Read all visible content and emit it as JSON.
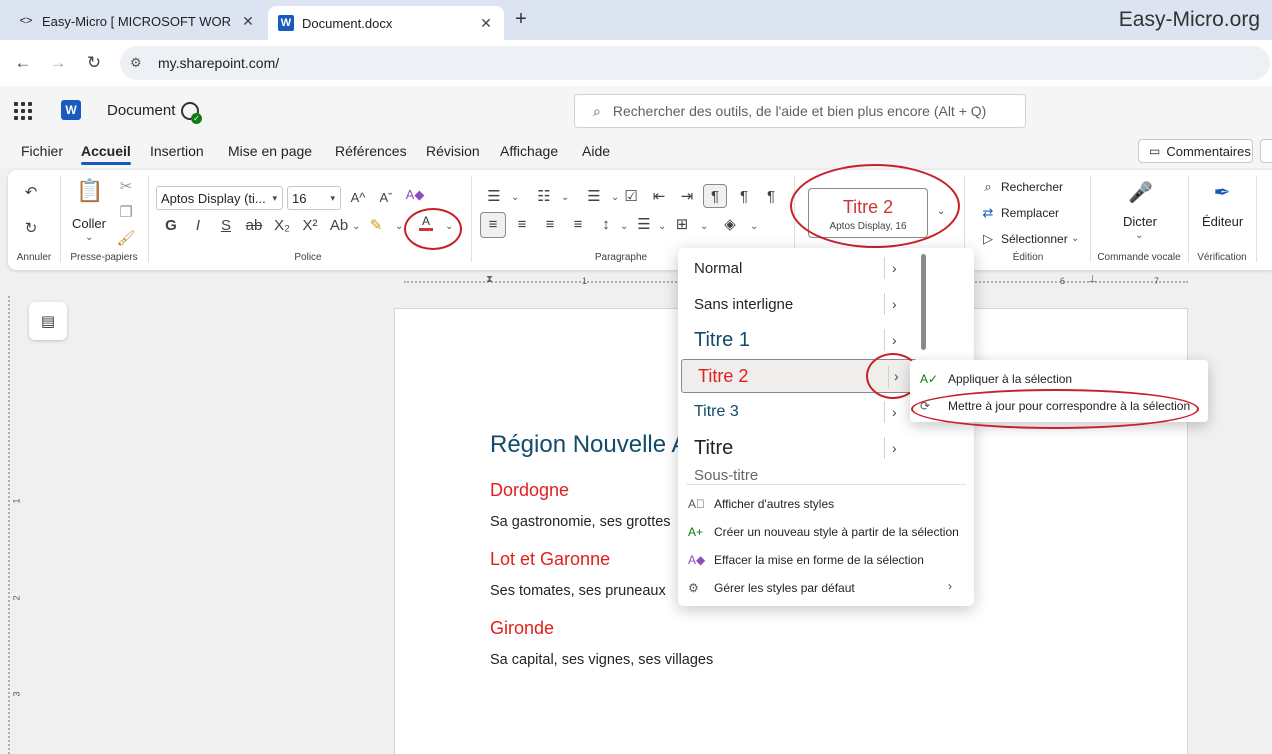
{
  "browser": {
    "tabs": [
      {
        "title": "Easy-Micro [ MICROSOFT WOR",
        "icon": "code-icon"
      },
      {
        "title": "Document.docx",
        "icon": "word-icon"
      }
    ],
    "brand": "Easy-Micro.org",
    "url": "my.sharepoint.com/"
  },
  "word": {
    "app_letter": "W",
    "doc_title": "Document",
    "search_placeholder": "Rechercher des outils, de l'aide et bien plus encore (Alt + Q)",
    "menu_tabs": [
      "Fichier",
      "Accueil",
      "Insertion",
      "Mise en page",
      "Références",
      "Révision",
      "Affichage",
      "Aide"
    ],
    "active_tab": "Accueil",
    "comments_label": "Commentaires"
  },
  "ribbon": {
    "groups": [
      "Annuler",
      "Presse-papiers",
      "Police",
      "Paragraphe",
      "Édition",
      "Commande vocale",
      "Vérification"
    ],
    "paste_label": "Coller",
    "font_name": "Aptos Display (ti...",
    "font_size": "16",
    "format_glyphs": {
      "bold": "G",
      "italic": "I",
      "underline": "S",
      "strike": "ab",
      "subscript": "X₂",
      "superscript": "X²",
      "case": "Ab",
      "font_color": "A",
      "grow": "A^",
      "shrink": "Aˇ"
    },
    "style_current": {
      "name": "Titre 2",
      "sub": "Aptos Display, 16"
    },
    "editing": [
      "Rechercher",
      "Remplacer",
      "Sélectionner"
    ],
    "dictate_label": "Dicter",
    "editor_label": "Éditeur",
    "accent_red": "#d13438",
    "annotation_red": "#c8202a"
  },
  "ruler": [
    "1",
    "6",
    "7"
  ],
  "vruler": [
    "1",
    "2",
    "3"
  ],
  "document": {
    "heading1": "Région Nouvelle A",
    "sections": [
      {
        "heading": "Dordogne",
        "text": "Sa gastronomie, ses grottes"
      },
      {
        "heading": "Lot et Garonne",
        "text": "Ses tomates, ses pruneaux"
      },
      {
        "heading": "Gironde",
        "text": "Sa capital, ses vignes, ses villages"
      }
    ],
    "heading1_color": "#124b6b",
    "heading2_color": "#e0201f"
  },
  "styles_menu": {
    "items": [
      {
        "label": "Normal"
      },
      {
        "label": "Sans interligne"
      },
      {
        "label": "Titre 1"
      },
      {
        "label": "Titre 2"
      },
      {
        "label": "Titre 3"
      },
      {
        "label": "Titre"
      },
      {
        "label": "Sous-titre"
      }
    ],
    "commands": [
      "Afficher d'autres styles",
      "Créer un nouveau style à partir de la sélection",
      "Effacer la mise en forme de la sélection",
      "Gérer les styles par défaut"
    ]
  },
  "submenu": {
    "items": [
      "Appliquer à la sélection",
      "Mettre à jour pour correspondre à la sélection"
    ]
  }
}
